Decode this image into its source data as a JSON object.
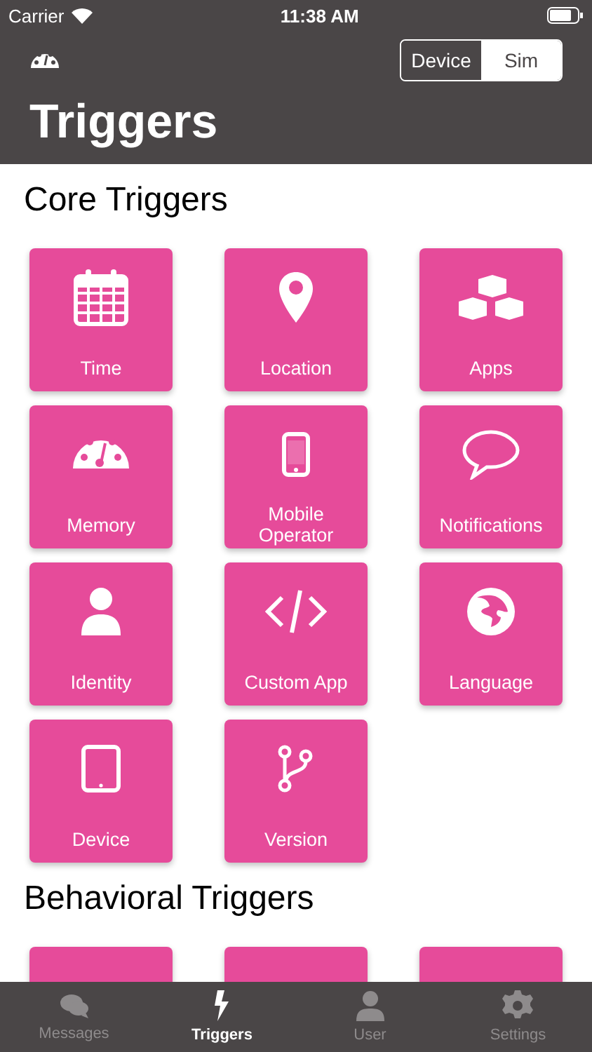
{
  "status_bar": {
    "carrier": "Carrier",
    "time": "11:38 AM"
  },
  "header": {
    "title": "Triggers",
    "segments": [
      {
        "label": "Device",
        "selected": false
      },
      {
        "label": "Sim",
        "selected": true
      }
    ]
  },
  "sections": [
    {
      "title": "Core Triggers",
      "tiles": [
        {
          "kind": "tile",
          "label": "Time"
        },
        {
          "kind": "tile",
          "label": "Location"
        },
        {
          "kind": "tile",
          "label": "Apps"
        },
        {
          "kind": "tile",
          "label": "Memory"
        },
        {
          "kind": "tile",
          "label": "Mobile Operator"
        },
        {
          "kind": "tile",
          "label": "Notifications"
        },
        {
          "kind": "tile",
          "label": "Identity"
        },
        {
          "kind": "tile",
          "label": "Custom App"
        },
        {
          "kind": "tile",
          "label": "Language"
        },
        {
          "kind": "tile",
          "label": "Device"
        },
        {
          "kind": "tile",
          "label": "Version"
        }
      ]
    },
    {
      "title": "Behavioral Triggers",
      "tiles": [
        {
          "kind": "tile"
        },
        {
          "kind": "tile"
        },
        {
          "kind": "tile"
        }
      ]
    }
  ],
  "tab_bar": [
    {
      "label": "Messages",
      "selected": false
    },
    {
      "label": "Triggers",
      "selected": true
    },
    {
      "label": "User",
      "selected": false
    },
    {
      "label": "Settings",
      "selected": false
    }
  ]
}
